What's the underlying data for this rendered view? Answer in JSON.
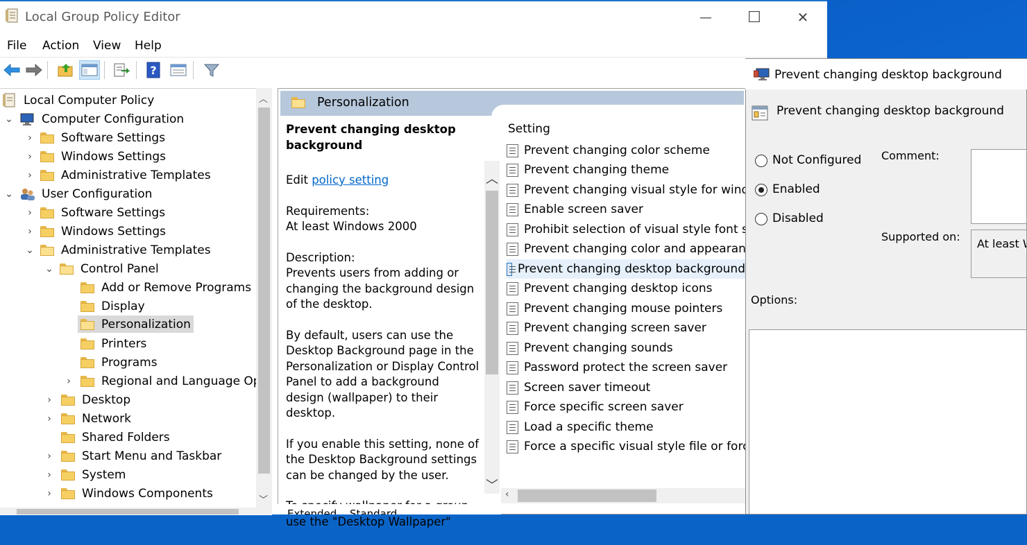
{
  "window": {
    "title": "Local Group Policy Editor"
  },
  "window_controls": {
    "minimize": "—",
    "maximize": "☐",
    "close": "✕"
  },
  "menu": [
    "File",
    "Action",
    "View",
    "Help"
  ],
  "toolbar": {
    "icons": [
      "back-arrow-icon",
      "forward-arrow-icon",
      "up-folder-icon",
      "show-hide-tree-icon",
      "export-list-icon",
      "help-icon",
      "properties-view-icon",
      "filter-icon"
    ]
  },
  "tree": {
    "root": "Local Computer Policy",
    "items": [
      {
        "label": "Computer Configuration"
      },
      {
        "label": "Software Settings"
      },
      {
        "label": "Windows Settings"
      },
      {
        "label": "Administrative Templates"
      },
      {
        "label": "User Configuration"
      },
      {
        "label": "Software Settings"
      },
      {
        "label": "Windows Settings"
      },
      {
        "label": "Administrative Templates"
      },
      {
        "label": "Control Panel"
      },
      {
        "label": "Add or Remove Programs"
      },
      {
        "label": "Display"
      },
      {
        "label": "Personalization"
      },
      {
        "label": "Printers"
      },
      {
        "label": "Programs"
      },
      {
        "label": "Regional and Language Opt"
      },
      {
        "label": "Desktop"
      },
      {
        "label": "Network"
      },
      {
        "label": "Shared Folders"
      },
      {
        "label": "Start Menu and Taskbar"
      },
      {
        "label": "System"
      },
      {
        "label": "Windows Components"
      }
    ]
  },
  "details": {
    "header": "Personalization",
    "policy_title": "Prevent changing desktop background",
    "edit_prefix": "Edit ",
    "edit_link": "policy setting",
    "requirements_label": "Requirements:",
    "requirements_value": "At least Windows 2000",
    "description_label": "Description:",
    "description_1": "Prevents users from adding or changing the background design of the desktop.",
    "description_2": "By default, users can use the Desktop Background page in the Personalization or Display Control Panel to add a background design (wallpaper) to their desktop.",
    "description_3": "If you enable this setting, none of the Desktop Background settings can be changed by the user.",
    "description_4": "To specify wallpaper for a group, use the \"Desktop Wallpaper\""
  },
  "settings": {
    "column_header": "Setting",
    "items": [
      "Prevent changing color scheme",
      "Prevent changing theme",
      "Prevent changing visual style for window",
      "Enable screen saver",
      "Prohibit selection of visual style font size",
      "Prevent changing color and appearance",
      "Prevent changing desktop background",
      "Prevent changing desktop icons",
      "Prevent changing mouse pointers",
      "Prevent changing screen saver",
      "Prevent changing sounds",
      "Password protect the screen saver",
      "Screen saver timeout",
      "Force specific screen saver",
      "Load a specific theme",
      "Force a specific visual style file or force W"
    ],
    "selected_index": 6
  },
  "tabs": [
    "Extended",
    "Standard"
  ],
  "dialog": {
    "title": "Prevent changing desktop background",
    "heading": "Prevent changing desktop background",
    "options": [
      "Not Configured",
      "Enabled",
      "Disabled"
    ],
    "selected": "Enabled",
    "comment_label": "Comment:",
    "supported_label": "Supported on:",
    "supported_value": "At least W",
    "options_label": "Options:"
  },
  "colors": {
    "accent": "#1e73c8",
    "pane_header": "#b7c8dc",
    "selection": "#d9d9d9",
    "link": "#0066cc"
  }
}
